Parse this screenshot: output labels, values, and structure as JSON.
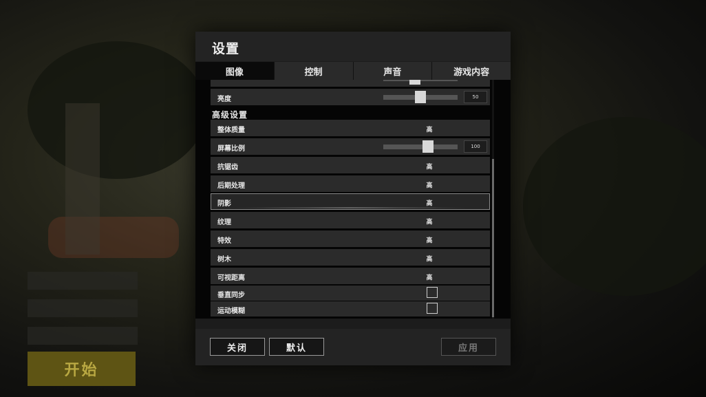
{
  "background": {
    "start_button": "开始"
  },
  "dialog": {
    "title": "设置",
    "tabs": [
      {
        "label": "图像",
        "active": true
      },
      {
        "label": "控制",
        "active": false
      },
      {
        "label": "声音",
        "active": false
      },
      {
        "label": "游戏内容",
        "active": false
      }
    ],
    "brightness": {
      "label": "亮度",
      "value": "50",
      "level": 0.5
    },
    "advanced_section": "高级设置",
    "rows": {
      "overall_quality": {
        "label": "整体质量",
        "value": "高"
      },
      "screen_scale": {
        "label": "屏幕比例",
        "value": "100",
        "level": 0.6
      },
      "anti_aliasing": {
        "label": "抗锯齿",
        "value": "高"
      },
      "post_processing": {
        "label": "后期处理",
        "value": "高"
      },
      "shadows": {
        "label": "阴影",
        "value": "高"
      },
      "texture": {
        "label": "纹理",
        "value": "高"
      },
      "effects": {
        "label": "特效",
        "value": "高"
      },
      "foliage": {
        "label": "树木",
        "value": "高"
      },
      "view_distance": {
        "label": "可视距离",
        "value": "高"
      },
      "vsync": {
        "label": "垂直同步",
        "checked": false
      },
      "motion_blur": {
        "label": "运动模糊",
        "checked": false
      }
    },
    "buttons": {
      "close": "关闭",
      "default": "默认",
      "apply": "应用"
    }
  }
}
